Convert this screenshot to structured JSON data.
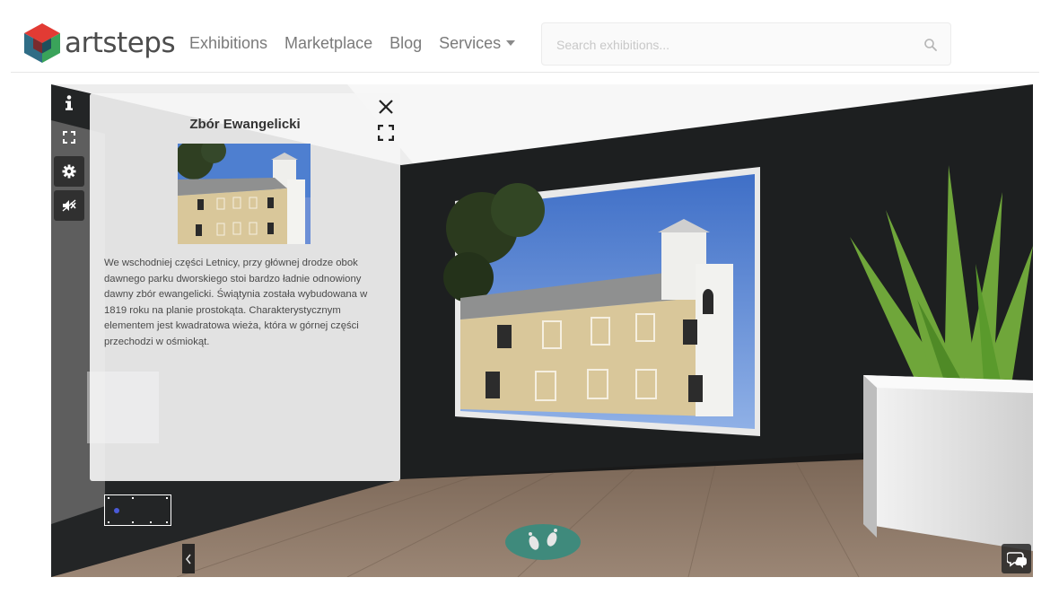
{
  "header": {
    "logo_text": "artsteps",
    "nav": [
      {
        "label": "Exhibitions"
      },
      {
        "label": "Marketplace"
      },
      {
        "label": "Blog"
      },
      {
        "label": "Services"
      }
    ],
    "search": {
      "placeholder": "Search exhibitions..."
    }
  },
  "viewer": {
    "toolbar": [
      {
        "name": "info-icon"
      },
      {
        "name": "fullscreen-icon"
      },
      {
        "name": "settings-icon"
      },
      {
        "name": "mute-icon"
      }
    ],
    "info_panel": {
      "title": "Zbór Ewangelicki",
      "description": "We wschodniej części Letnicy, przy głównej drodze obok dawnego parku dworskiego stoi bardzo ładnie odnowiony dawny zbór ewangelicki. Świątynia została wybudowana w 1819 roku na planie prostokąta. Charakterystycznym elementem jest kwadratowa wieża, która w górnej części przechodzi w ośmiokąt."
    },
    "colors": {
      "wall": "#1d1f20",
      "floor": "#8a7664",
      "ceiling": "#e8e8e8",
      "plant": "#6fa63a",
      "footsteps": "#3f8a7c",
      "church_facade": "#d9c79a",
      "roof": "#8f9090",
      "sky": "#4e7fd0"
    }
  }
}
